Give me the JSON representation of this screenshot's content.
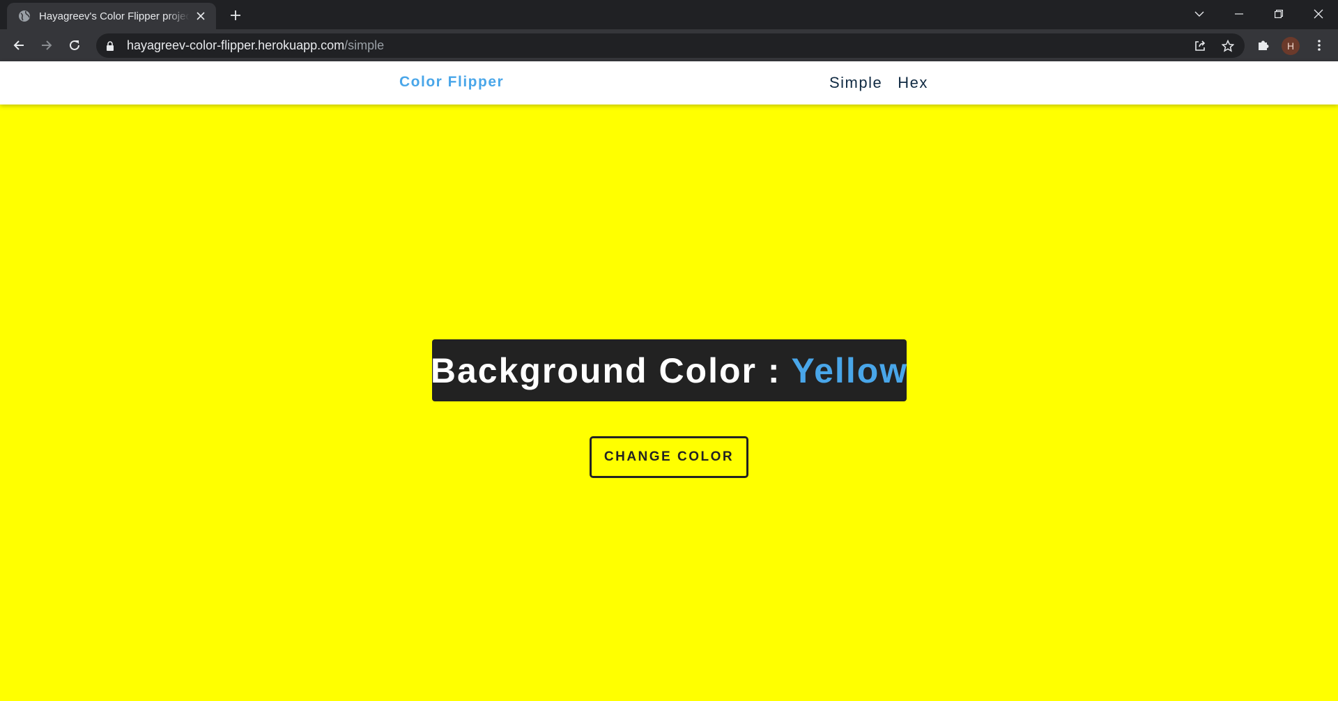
{
  "browser": {
    "tab": {
      "title": "Hayagreev's Color Flipper project"
    },
    "url": {
      "domain": "hayagreev-color-flipper.herokuapp.com",
      "path": "/simple"
    },
    "profile_initial": "H"
  },
  "site": {
    "brand": "Color Flipper",
    "nav_links": [
      "Simple",
      "Hex"
    ]
  },
  "main": {
    "heading_prefix": "Background Color : ",
    "color_name": "Yellow",
    "button_label": "CHANGE COLOR"
  },
  "colors": {
    "page_background": "#ffff00",
    "accent": "#49a6e9",
    "heading_box": "#222222"
  },
  "icons": {
    "tab_favicon": "globe-icon",
    "tab_close": "close-icon",
    "new_tab": "plus-icon",
    "tab_search": "chevron-down-icon",
    "minimize": "minimize-icon",
    "restore": "restore-icon",
    "close_window": "close-icon",
    "back": "arrow-left-icon",
    "forward": "arrow-right-icon",
    "reload": "reload-icon",
    "lock": "lock-icon",
    "share": "share-icon",
    "bookmark": "star-icon",
    "extensions": "puzzle-icon",
    "menu": "kebab-menu-icon"
  }
}
